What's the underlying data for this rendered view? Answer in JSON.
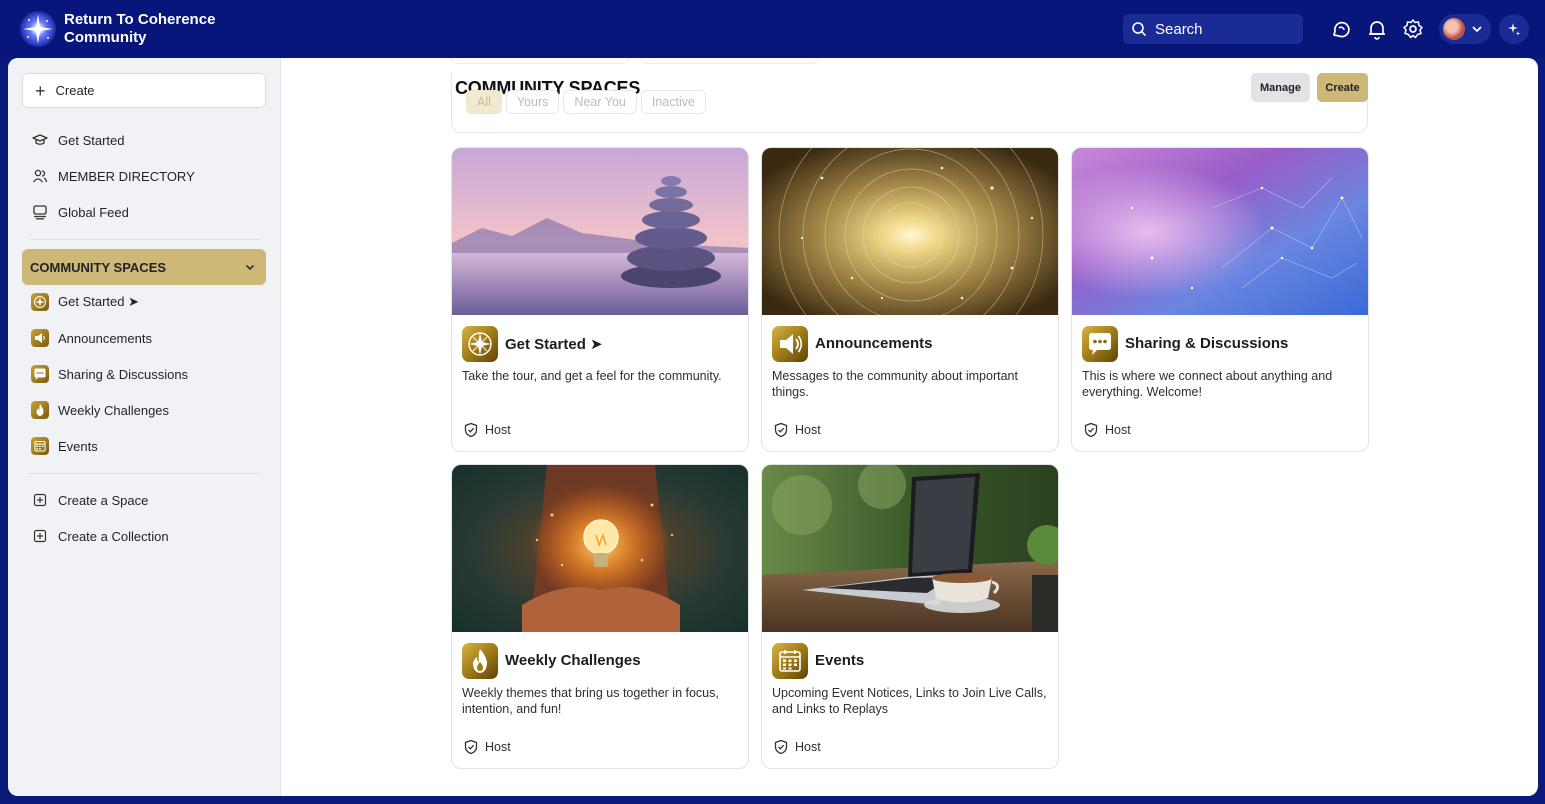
{
  "brand": {
    "line1": "Return To Coherence",
    "line2": "Community"
  },
  "search": {
    "label": "Search"
  },
  "sidebar": {
    "create_label": "Create",
    "nav": [
      {
        "label": "Get Started",
        "icon": "graduation-cap-icon"
      },
      {
        "label": "MEMBER DIRECTORY",
        "icon": "members-icon"
      },
      {
        "label": "Global Feed",
        "icon": "feed-icon"
      }
    ],
    "section_label": "COMMUNITY SPACES",
    "spaces": [
      {
        "label": "Get Started ➤",
        "icon": "compass-icon"
      },
      {
        "label": "Announcements",
        "icon": "megaphone-icon"
      },
      {
        "label": "Sharing & Discussions",
        "icon": "chat-bubble-icon"
      },
      {
        "label": "Weekly Challenges",
        "icon": "flame-icon"
      },
      {
        "label": "Events",
        "icon": "calendar-icon"
      }
    ],
    "actions": [
      {
        "label": "Create a Space",
        "icon": "plus-square-icon"
      },
      {
        "label": "Create a Collection",
        "icon": "plus-square-icon"
      }
    ]
  },
  "main": {
    "title": "COMMUNITY SPACES",
    "filters": [
      "All",
      "Yours",
      "Near You",
      "Inactive"
    ],
    "manage_label": "Manage",
    "create_label": "Create",
    "cards": [
      {
        "title": "Get Started ➤",
        "desc": "Take the tour, and get a feel for the community.",
        "host": "Host",
        "icon": "compass-icon"
      },
      {
        "title": "Announcements",
        "desc": "Messages to the community about important things.",
        "host": "Host",
        "icon": "megaphone-icon"
      },
      {
        "title": "Sharing & Discussions",
        "desc": "This is where we connect about anything and everything. Welcome!",
        "host": "Host",
        "icon": "chat-bubble-icon"
      },
      {
        "title": "Weekly Challenges",
        "desc": "Weekly themes that bring us together in focus, intention, and fun!",
        "host": "Host",
        "icon": "flame-icon"
      },
      {
        "title": "Events",
        "desc": "Upcoming Event Notices, Links to Join Live Calls, and Links to Replays",
        "host": "Host",
        "icon": "calendar-icon"
      }
    ]
  },
  "colors": {
    "topbar": "#08157a",
    "accent_gold": "#cdb878",
    "sidebar_bg": "#f1f2f6"
  }
}
